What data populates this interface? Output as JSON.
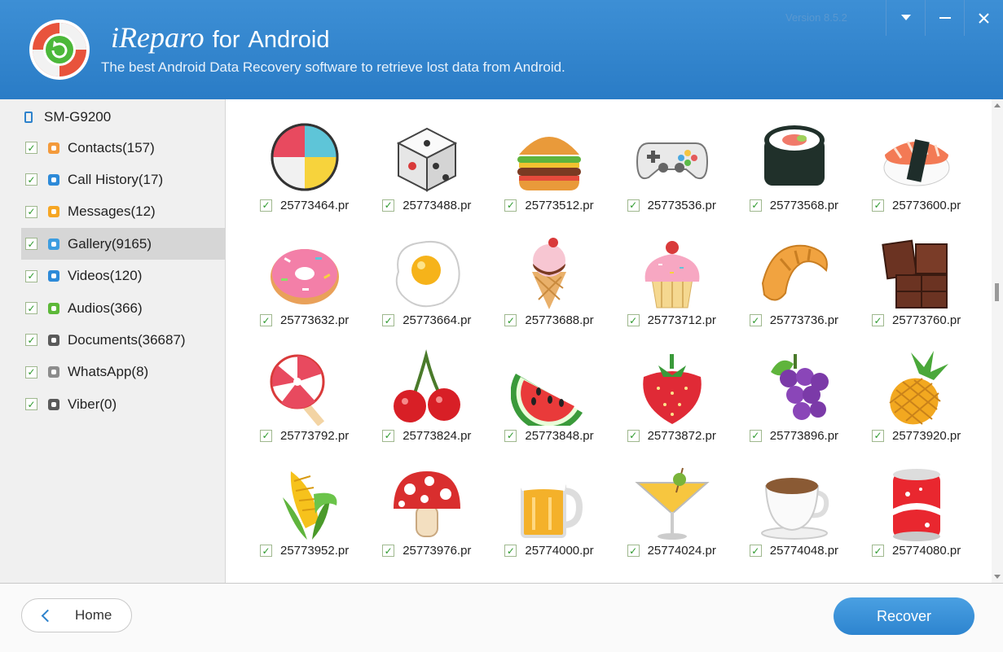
{
  "header": {
    "brand": "iReparo",
    "for": "for",
    "product": "Android",
    "subtitle": "The best Android Data Recovery software to retrieve lost data from Android.",
    "version": "Version 8.5.2"
  },
  "sidebar": {
    "device": "SM-G9200",
    "items": [
      {
        "label": "Contacts(157)",
        "icon": "contacts-icon",
        "color": "#f39a3b"
      },
      {
        "label": "Call History(17)",
        "icon": "call-history-icon",
        "color": "#2d8ad8"
      },
      {
        "label": "Messages(12)",
        "icon": "messages-icon",
        "color": "#f6a623"
      },
      {
        "label": "Gallery(9165)",
        "icon": "gallery-icon",
        "color": "#3c9de0",
        "selected": true
      },
      {
        "label": "Videos(120)",
        "icon": "videos-icon",
        "color": "#2d8ad8"
      },
      {
        "label": "Audios(366)",
        "icon": "audios-icon",
        "color": "#5cb838"
      },
      {
        "label": "Documents(36687)",
        "icon": "documents-icon",
        "color": "#5a5a5a"
      },
      {
        "label": "WhatsApp(8)",
        "icon": "whatsapp-icon",
        "color": "#8c8c8c"
      },
      {
        "label": "Viber(0)",
        "icon": "viber-icon",
        "color": "#5a5a5a"
      }
    ]
  },
  "gallery": {
    "items": [
      {
        "name": "25773464.pr",
        "image": "beach-ball"
      },
      {
        "name": "25773488.pr",
        "image": "dice"
      },
      {
        "name": "25773512.pr",
        "image": "hamburger"
      },
      {
        "name": "25773536.pr",
        "image": "game-controller"
      },
      {
        "name": "25773568.pr",
        "image": "sushi-roll"
      },
      {
        "name": "25773600.pr",
        "image": "salmon-nigiri"
      },
      {
        "name": "25773632.pr",
        "image": "donut"
      },
      {
        "name": "25773664.pr",
        "image": "fried-egg"
      },
      {
        "name": "25773688.pr",
        "image": "ice-cream-cone"
      },
      {
        "name": "25773712.pr",
        "image": "cupcake"
      },
      {
        "name": "25773736.pr",
        "image": "croissant"
      },
      {
        "name": "25773760.pr",
        "image": "chocolate-bar"
      },
      {
        "name": "25773792.pr",
        "image": "lollipop"
      },
      {
        "name": "25773824.pr",
        "image": "cherries"
      },
      {
        "name": "25773848.pr",
        "image": "watermelon"
      },
      {
        "name": "25773872.pr",
        "image": "strawberry"
      },
      {
        "name": "25773896.pr",
        "image": "grapes"
      },
      {
        "name": "25773920.pr",
        "image": "pineapple"
      },
      {
        "name": "25773952.pr",
        "image": "corn"
      },
      {
        "name": "25773976.pr",
        "image": "mushroom"
      },
      {
        "name": "25774000.pr",
        "image": "beer-mug"
      },
      {
        "name": "25774024.pr",
        "image": "cocktail"
      },
      {
        "name": "25774048.pr",
        "image": "coffee-cup"
      },
      {
        "name": "25774080.pr",
        "image": "soda-can"
      }
    ]
  },
  "footer": {
    "home_label": "Home",
    "recover_label": "Recover"
  }
}
